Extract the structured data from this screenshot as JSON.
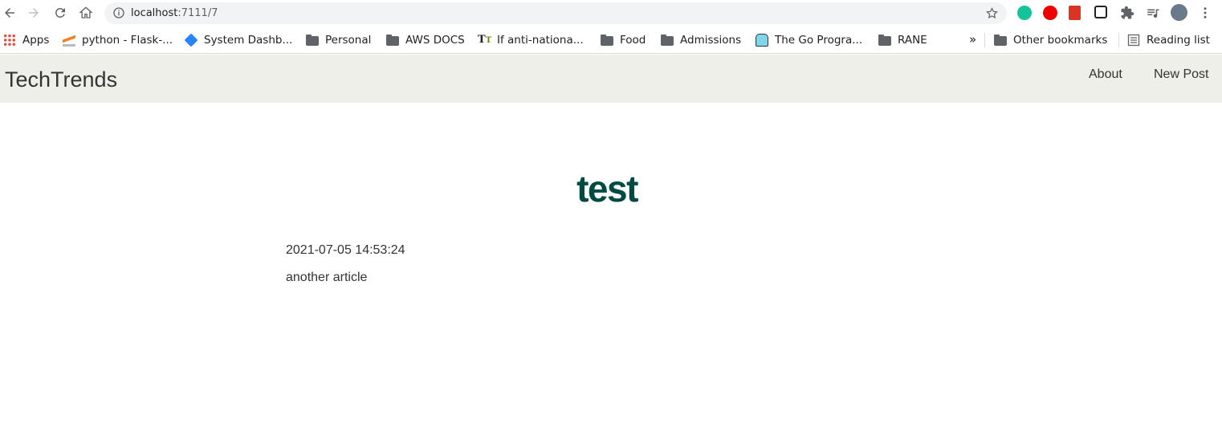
{
  "browser": {
    "url_host": "localhost",
    "url_path": ":7111/7"
  },
  "bookmarks": [
    {
      "label": "Apps",
      "icon": "apps-grid-icon"
    },
    {
      "label": "python - Flask-...",
      "icon": "stackoverflow-icon"
    },
    {
      "label": "System Dashb...",
      "icon": "jira-icon"
    },
    {
      "label": "Personal",
      "icon": "folder-icon"
    },
    {
      "label": "AWS DOCS",
      "icon": "folder-icon"
    },
    {
      "label": "If anti-nationa...",
      "icon": "text-t-icon"
    },
    {
      "label": "Food",
      "icon": "folder-icon"
    },
    {
      "label": "Admissions",
      "icon": "folder-icon"
    },
    {
      "label": "The Go Progra...",
      "icon": "gopher-icon"
    },
    {
      "label": "RANE",
      "icon": "folder-icon"
    }
  ],
  "bookmarks_overflow": "»",
  "other_bookmarks": "Other bookmarks",
  "reading_list": "Reading list",
  "navbar": {
    "brand": "TechTrends",
    "links": [
      "About",
      "New Post"
    ]
  },
  "post": {
    "title": "test",
    "created": "2021-07-05 14:53:24",
    "content": "another article"
  },
  "colors": {
    "navbar_bg": "#efefe9",
    "title_color": "#004a44"
  }
}
